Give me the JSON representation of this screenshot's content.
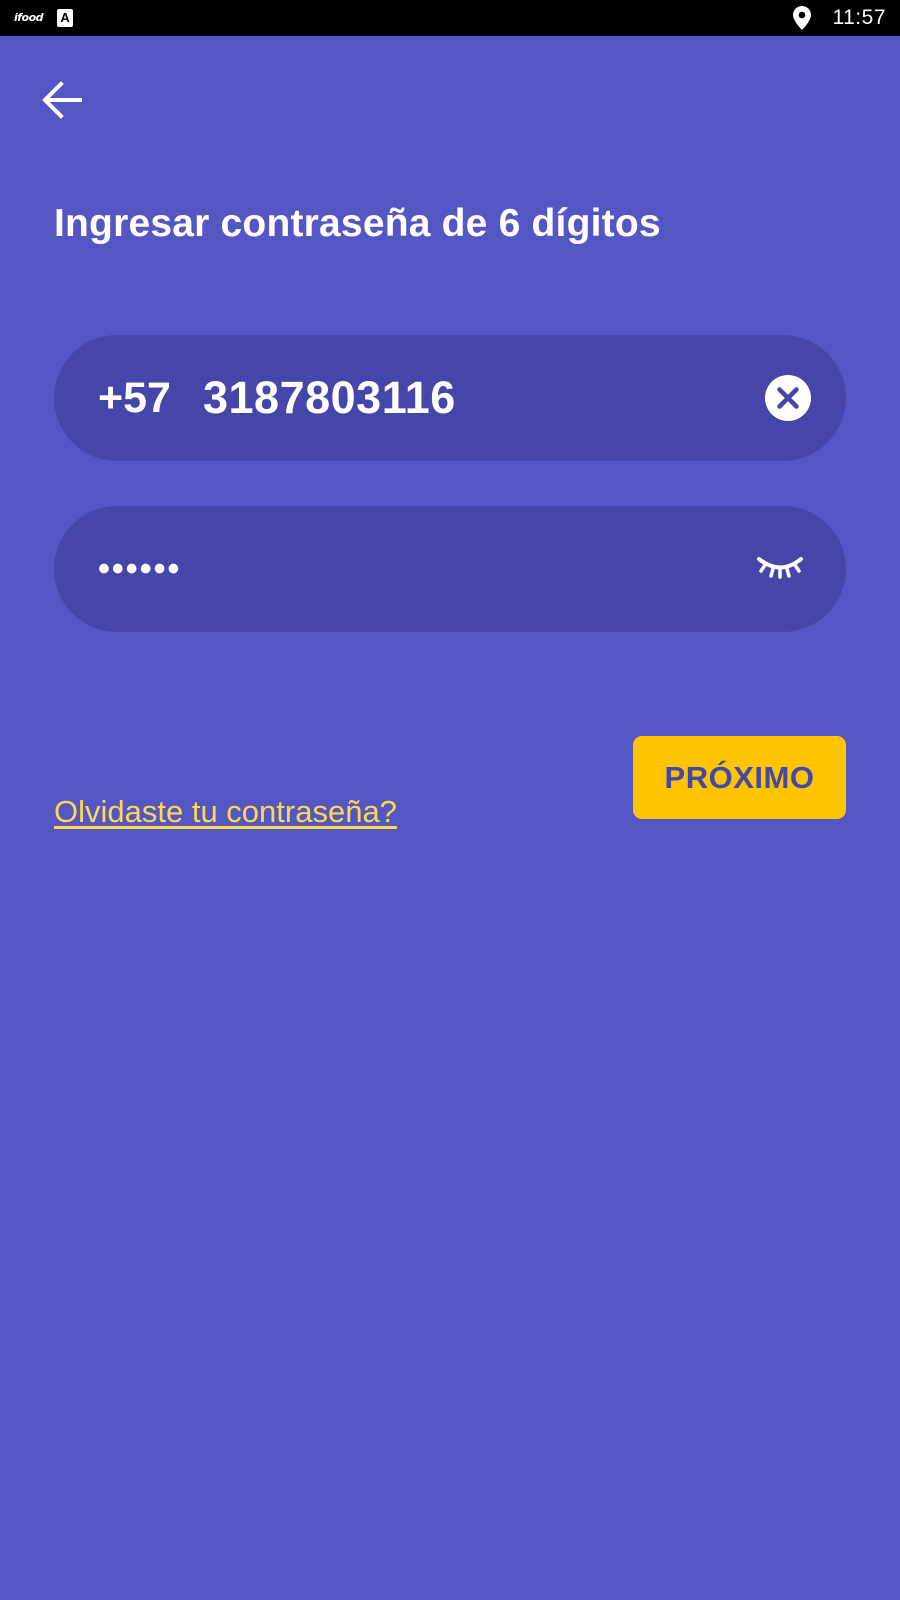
{
  "status_bar": {
    "time": "11:57",
    "app_icon_text": "ifood",
    "notification_icon_text": "A",
    "icons": [
      "ifood-icon",
      "text-a-icon",
      "location-pin-icon"
    ]
  },
  "header": {
    "back_icon": "arrow-left-icon"
  },
  "title": "Ingresar contraseña de 6 dígitos",
  "phone_field": {
    "country_code": "+57",
    "number": "3187803116",
    "clear_icon": "clear-circle-icon"
  },
  "password_field": {
    "masked_value": "••••••",
    "toggle_icon": "eye-closed-icon"
  },
  "forgot_link": "Olvidaste tu contraseña?",
  "next_button": "PRÓXIMO",
  "colors": {
    "background": "#5457c3",
    "field_background": "#4646aa",
    "accent_yellow": "#ffc400",
    "link_yellow": "#ffd84d",
    "button_text": "#4548a8",
    "status_bar": "#000000"
  }
}
